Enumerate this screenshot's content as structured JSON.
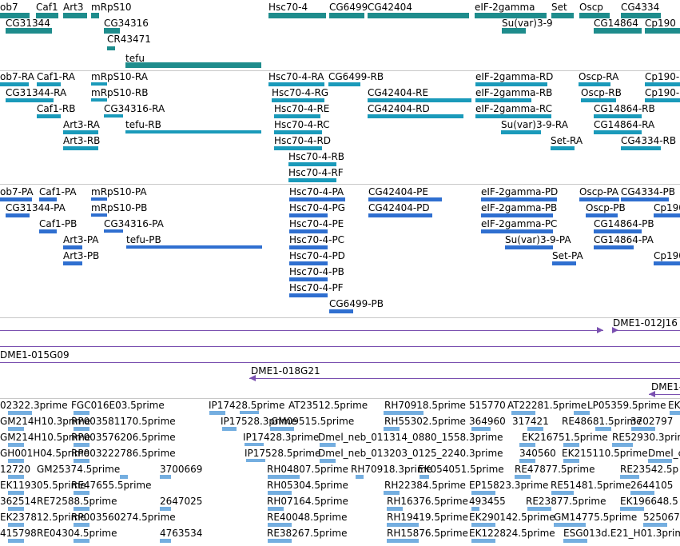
{
  "colors": {
    "gene": "#1e8c8c",
    "transcript": "#1a9aba",
    "protein": "#2f6fd0",
    "clone": "#7a50b0",
    "est": "#74aee0",
    "separator": "#c8c8c8",
    "text": "#000000"
  },
  "gene_track": {
    "name": "genes",
    "labels": [
      "ob7",
      "Caf1",
      "Art3",
      "mRpS10",
      "Hsc70-4",
      "CG6499",
      "CG42404",
      "eIF-2gamma",
      "Set",
      "Oscp",
      "CG4334",
      "CG31344",
      "CG34316",
      "Su(var)3-9",
      "CG14864",
      "Cp190",
      "CR43471",
      "tefu"
    ]
  },
  "transcript_track": {
    "name": "transcripts",
    "labels": [
      "ob7-RA",
      "Caf1-RA",
      "mRpS10-RA",
      "Hsc70-4-RA",
      "CG6499-RB",
      "eIF-2gamma-RD",
      "Oscp-RA",
      "Cp190-",
      "CG31344-RA",
      "mRpS10-RB",
      "Hsc70-4-RG",
      "CG42404-RE",
      "eIF-2gamma-RB",
      "Oscp-RB",
      "Cp190-",
      "Caf1-RB",
      "CG34316-RA",
      "Hsc70-4-RE",
      "CG42404-RD",
      "eIF-2gamma-RC",
      "CG14864-RB",
      "Art3-RA",
      "tefu-RB",
      "Hsc70-4-RC",
      "Su(var)3-9-RA",
      "CG14864-RA",
      "Art3-RB",
      "Hsc70-4-RD",
      "Set-RA",
      "CG4334-RB",
      "Hsc70-4-RB",
      "Hsc70-4-RF"
    ]
  },
  "protein_track": {
    "name": "proteins",
    "labels": [
      "ob7-PA",
      "Caf1-PA",
      "mRpS10-PA",
      "Hsc70-4-PA",
      "CG42404-PE",
      "eIF-2gamma-PD",
      "Oscp-PA",
      "CG4334-PB",
      "CG31344-PA",
      "mRpS10-PB",
      "Hsc70-4-PG",
      "CG42404-PD",
      "eIF-2gamma-PB",
      "Oscp-PB",
      "Cp190",
      "Caf1-PB",
      "CG34316-PA",
      "Hsc70-4-PE",
      "eIF-2gamma-PC",
      "CG14864-PB",
      "Art3-PA",
      "tefu-PB",
      "Hsc70-4-PC",
      "Su(var)3-9-PA",
      "CG14864-PA",
      "Art3-PB",
      "Hsc70-4-PD",
      "Set-PA",
      "Cp190",
      "Hsc70-4-PB",
      "Hsc70-4-PF",
      "CG6499-PB"
    ]
  },
  "clone_track": {
    "name": "clones",
    "labels": [
      "DME1-012J16",
      "DME1-015G09",
      "DME1-018G21",
      "DME1-"
    ]
  },
  "est_track": {
    "name": "ESTs",
    "labels": [
      "02322.3prime",
      "FGC016E03.5prime",
      "IP17428.5prime",
      "AT23512.5prime",
      "RH70918.5prime",
      "515770",
      "AT22281.5prime",
      "LP05359.5prime",
      "EK",
      "GM214H10.3prime",
      "RP003581170.5prime",
      "IP17528.3prime",
      "GM09515.5prime",
      "RH55302.5prime",
      "364960",
      "317421",
      "RE48681.5prime",
      "3702797",
      "GM214H10.5prime",
      "RP003576206.5prime",
      "IP17428.3prime",
      "Dmel_neb_011314_0880_1558.3prime",
      "EK216751.5prime",
      "RE52930.3prime",
      "GH001H04.5prime",
      "RP003222786.5prime",
      "IP17528.5prime",
      "Dmel_neb_013203_0125_2240.3prime",
      "340560",
      "EK215110.5prime",
      "Dmel_c",
      "12720",
      "GM25374.5prime",
      "3700669",
      "RH04807.5prime",
      "RH70918.3prime",
      "EK054051.5prime",
      "RE47877.5prime",
      "RE23542.5p",
      "EK119305.5prime",
      "RE47655.5prime",
      "RH05304.5prime",
      "RH22384.5prime",
      "EP15823.3prime",
      "RE51481.5prime",
      "2644105",
      "362514",
      "RE72588.5prime",
      "2647025",
      "RH07164.5prime",
      "RH16376.5prime",
      "493455",
      "RE23877.5prime",
      "EK196648.5",
      "EK237812.5prime",
      "RP003560274.5prime",
      "RE40048.5prime",
      "RH19419.5prime",
      "EK290142.5prime",
      "GM14775.5prime",
      "525067",
      "415798",
      "RE04304.5prime",
      "4763534",
      "RE38267.5prime",
      "RH15876.5prime",
      "EK122824.5prime",
      "ESG013d.E21_H01.3prim"
    ]
  }
}
